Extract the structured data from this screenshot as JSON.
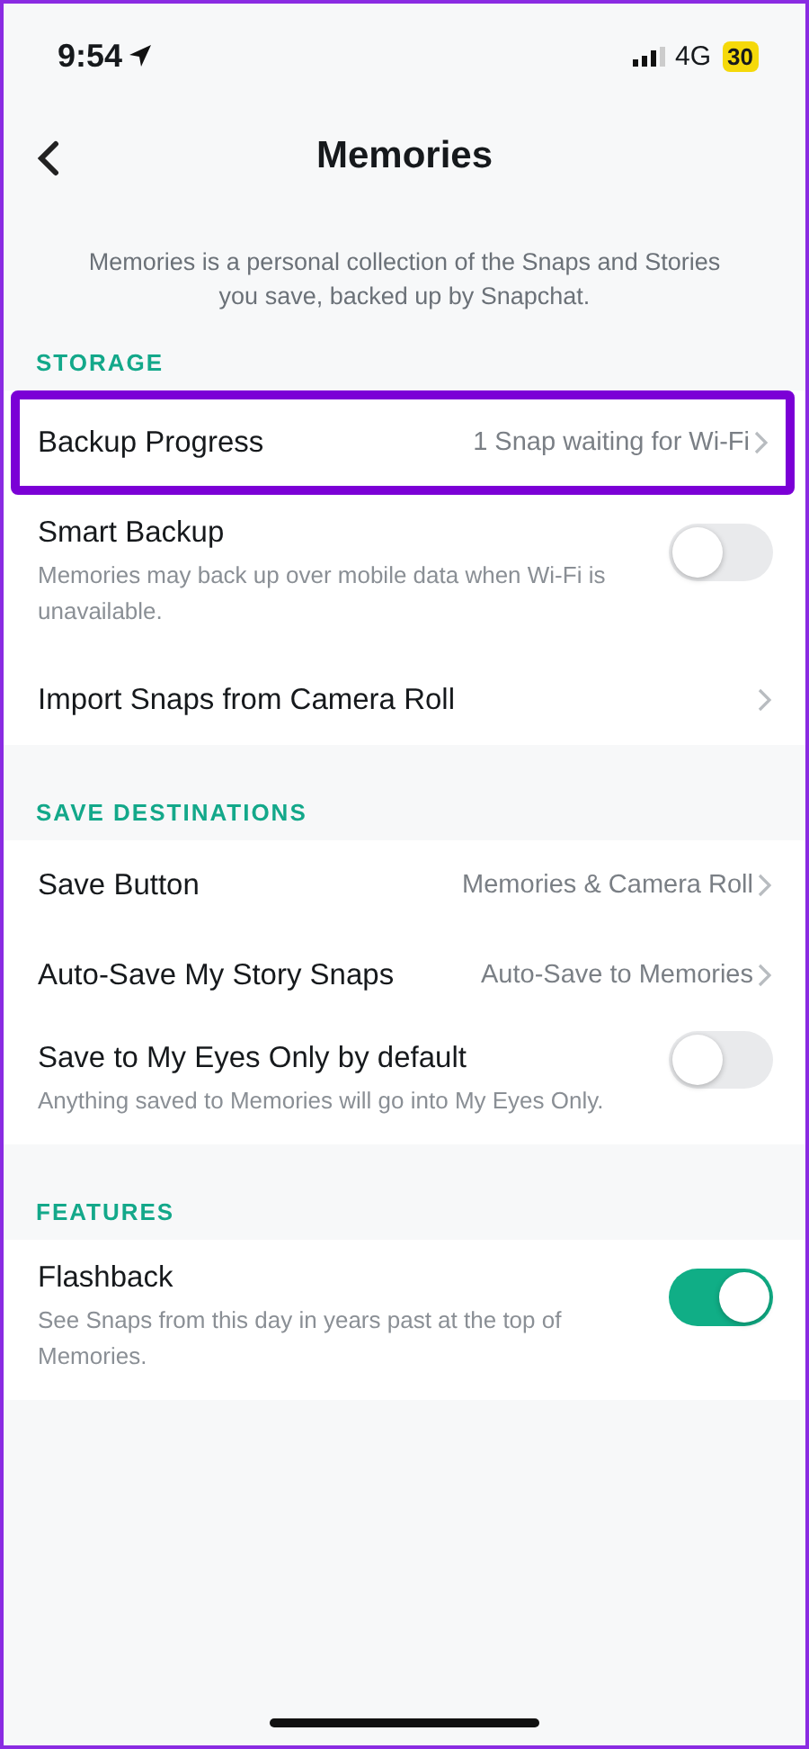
{
  "status_bar": {
    "time": "9:54",
    "network": "4G",
    "battery": "30"
  },
  "header": {
    "title": "Memories"
  },
  "intro": "Memories is a personal collection of the Snaps and Stories you save, backed up by Snapchat.",
  "sections": [
    {
      "title": "STORAGE",
      "items": [
        {
          "kind": "link",
          "label": "Backup Progress",
          "value": "1 Snap waiting for Wi-Fi",
          "highlighted": true
        },
        {
          "kind": "toggle",
          "label": "Smart Backup",
          "description": "Memories may back up over mobile data when Wi-Fi is unavailable.",
          "on": false,
          "highlighted": false
        },
        {
          "kind": "link",
          "label": "Import Snaps from Camera Roll",
          "highlighted": false
        }
      ]
    },
    {
      "title": "SAVE DESTINATIONS",
      "items": [
        {
          "kind": "link",
          "label": "Save Button",
          "value": "Memories & Camera Roll",
          "highlighted": false
        },
        {
          "kind": "link",
          "label": "Auto-Save My Story Snaps",
          "value": "Auto-Save to Memories",
          "highlighted": false
        },
        {
          "kind": "toggle",
          "label": "Save to My Eyes Only by default",
          "description": "Anything saved to Memories will go into My Eyes Only.",
          "on": false,
          "highlighted": false
        }
      ]
    },
    {
      "title": "FEATURES",
      "items": [
        {
          "kind": "toggle",
          "label": "Flashback",
          "description": "See Snaps from this day in years past at the top of Memories.",
          "on": true,
          "highlighted": false
        }
      ]
    }
  ]
}
